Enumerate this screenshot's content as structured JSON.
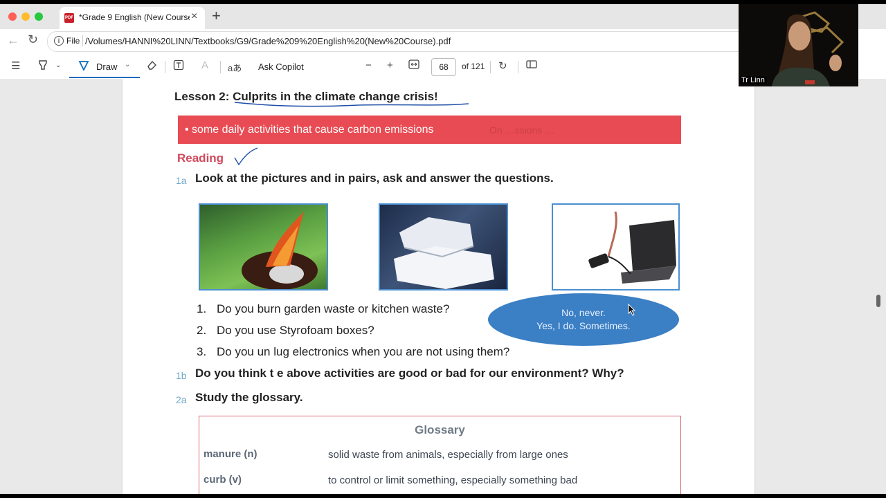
{
  "browser": {
    "tab_title": "*Grade 9 English (New Course).",
    "address_prefix": "File",
    "url": "/Volumes/HANNI%20LINN/Textbooks/G9/Grade%209%20English%20(New%20Course).pdf"
  },
  "toolbar": {
    "draw_label": "Draw",
    "copilot_label": "Ask Copilot",
    "page_number": "68",
    "page_total": "of 121",
    "translate_glyph": "aあ"
  },
  "document": {
    "lesson_title": "Lesson 2: Culprits in the climate change crisis!",
    "objective": "• some daily activities that cause carbon emissions",
    "objective_ghost": "On …ssions …",
    "reading_heading": "Reading",
    "q1a_num": "1a",
    "q1a_text": "Look at the pictures and in pairs, ask and answer the questions.",
    "questions": [
      {
        "num": "1.",
        "text": "Do you burn garden waste or kitchen waste?"
      },
      {
        "num": "2.",
        "text": "Do you use Styrofoam boxes?"
      },
      {
        "num": "3.",
        "text": "Do you un lug electronics when you are not using them?"
      }
    ],
    "bubble_line1": "No, never.",
    "bubble_line2": "Yes, I do. Sometimes.",
    "q1b_num": "1b",
    "q1b_text": "Do you think t e above activities are good or bad for our environment? Why?",
    "q2a_num": "2a",
    "q2a_text": "Study the glossary.",
    "glossary": {
      "title": "Glossary",
      "entries": [
        {
          "term": "manure (n)",
          "definition": "solid waste from animals, especially from large ones"
        },
        {
          "term": "curb (v)",
          "definition": "to control or limit something, especially something bad"
        }
      ]
    }
  },
  "webcam": {
    "name": "Tr Linn"
  },
  "colors": {
    "accent": "#0f6cbd",
    "objective_band": "#e84b53",
    "reading_heading": "#d1495b",
    "speech_bubble": "#3b7fc4",
    "glossary_border": "#d9646e"
  }
}
